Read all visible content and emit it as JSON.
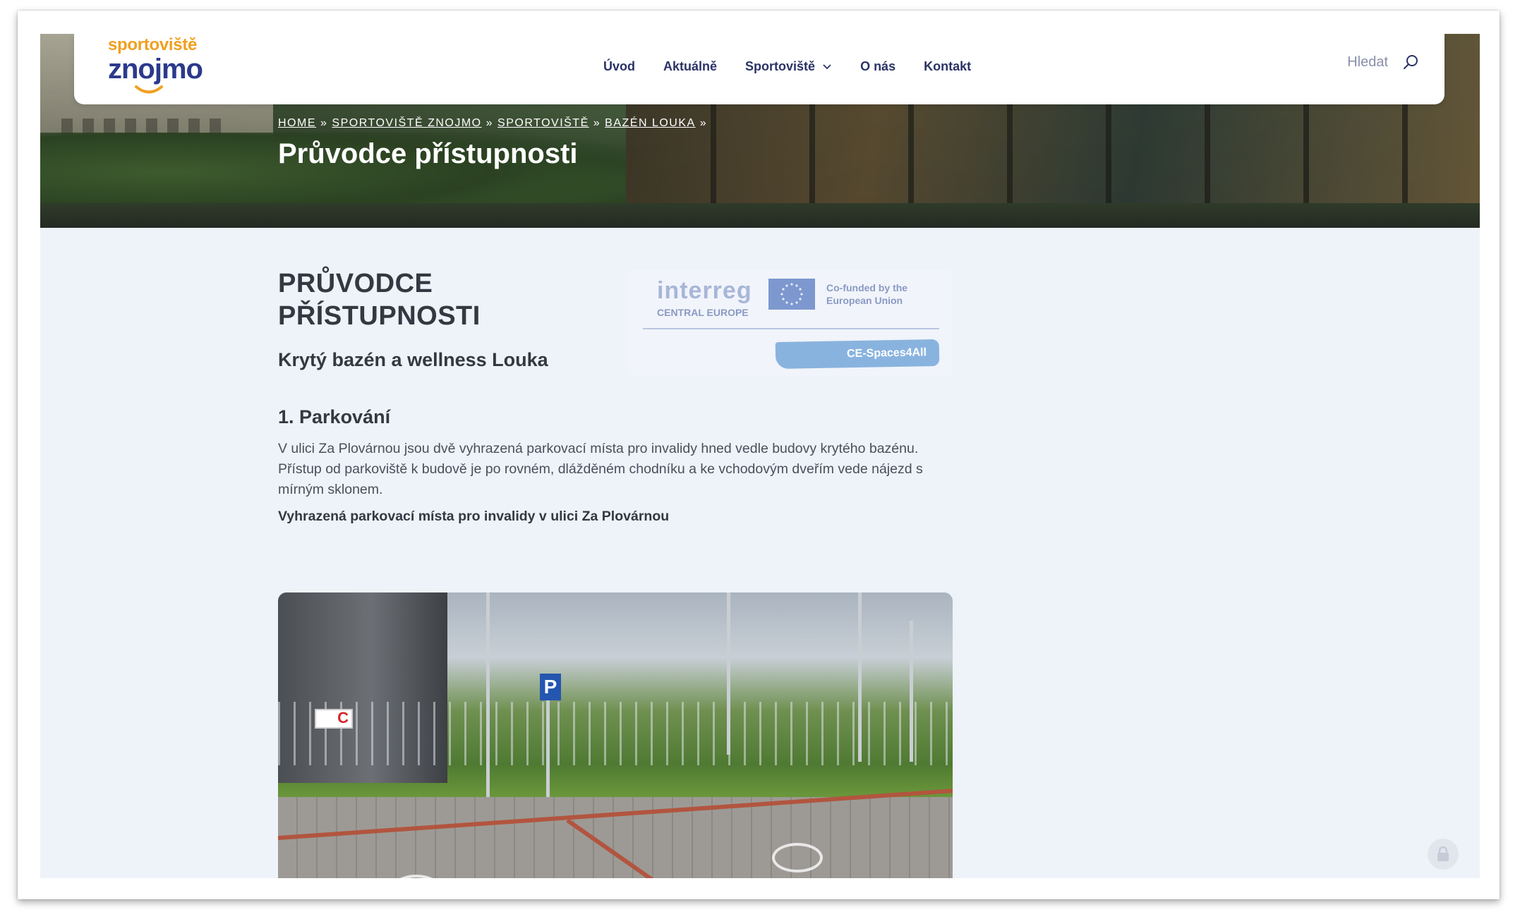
{
  "header": {
    "logo": {
      "top": "sportoviště",
      "main": "znojmo"
    },
    "nav": [
      {
        "label": "Úvod"
      },
      {
        "label": "Aktuálně"
      },
      {
        "label": "Sportoviště",
        "has_dropdown": true
      },
      {
        "label": "O nás"
      },
      {
        "label": "Kontakt"
      }
    ],
    "search": {
      "label": "Hledat",
      "icon": "search-icon"
    }
  },
  "breadcrumb": {
    "items": [
      "HOME",
      "SPORTOVIŠTĚ ZNOJMO",
      "SPORTOVIŠTĚ",
      "BAZÉN LOUKA"
    ],
    "separator": "»"
  },
  "hero": {
    "title": "Průvodce přístupnosti"
  },
  "content": {
    "title": "PRŮVODCE PŘÍSTUPNOSTI",
    "subtitle": "Krytý bazén a wellness Louka",
    "badge": {
      "program": "interreg",
      "program_sub": "CENTRAL EUROPE",
      "eu_text": "Co-funded by the European Union",
      "project": "CE-Spaces4All"
    },
    "section_1": {
      "heading": "1. Parkování",
      "paragraph": "V ulici Za Plovárnou jsou dvě vyhrazená parkovací místa pro invalidy hned vedle budovy krytého bazénu. Přístup od parkoviště k budově je po rovném, dlážděném chodníku a ke vchodovým dveřím vede nájezd s mírným sklonem.",
      "caption": "Vyhrazená parkovací místa pro invalidy v ulici Za Plovárnou"
    },
    "photo": {
      "sign": "P",
      "building_sign": "C"
    }
  },
  "colors": {
    "logo_orange": "#f0a020",
    "logo_blue": "#2b3a8c",
    "nav_text": "#2b3366",
    "page_bg": "#eef2f9",
    "text_dark": "#333842"
  }
}
